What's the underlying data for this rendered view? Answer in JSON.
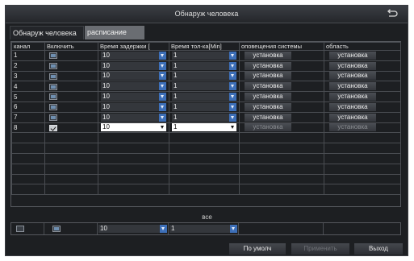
{
  "window": {
    "title": "Обнаруж человека"
  },
  "tabs": [
    {
      "label": "Обнаруж человека",
      "active": false
    },
    {
      "label": "расписание",
      "active": true
    }
  ],
  "table": {
    "headers": [
      "канал",
      "Включить",
      "Время задержки [",
      "Время тол-ка[Min]",
      "оповещения системы",
      "область"
    ],
    "rows": [
      {
        "channel": "1",
        "enabled": true,
        "delay": "10",
        "hold": "1",
        "alert": "установка",
        "area": "установка"
      },
      {
        "channel": "2",
        "enabled": true,
        "delay": "10",
        "hold": "1",
        "alert": "установка",
        "area": "установка"
      },
      {
        "channel": "3",
        "enabled": true,
        "delay": "10",
        "hold": "1",
        "alert": "установка",
        "area": "установка"
      },
      {
        "channel": "4",
        "enabled": true,
        "delay": "10",
        "hold": "1",
        "alert": "установка",
        "area": "установка"
      },
      {
        "channel": "5",
        "enabled": true,
        "delay": "10",
        "hold": "1",
        "alert": "установка",
        "area": "установка"
      },
      {
        "channel": "6",
        "enabled": true,
        "delay": "10",
        "hold": "1",
        "alert": "установка",
        "area": "установка"
      },
      {
        "channel": "7",
        "enabled": true,
        "delay": "10",
        "hold": "1",
        "alert": "установка",
        "area": "установка"
      },
      {
        "channel": "8",
        "enabled": true,
        "delay": "10",
        "hold": "1",
        "alert": "установка",
        "area": "установка"
      }
    ]
  },
  "all": {
    "label": "все",
    "delay": "10",
    "hold": "1"
  },
  "buttons": {
    "default": "По умолч",
    "apply": "Применить",
    "exit": "Выход"
  },
  "colors": {
    "background": "#1d1f22",
    "accent": "#3d6fb8",
    "active_tab": "#6a6d72"
  }
}
